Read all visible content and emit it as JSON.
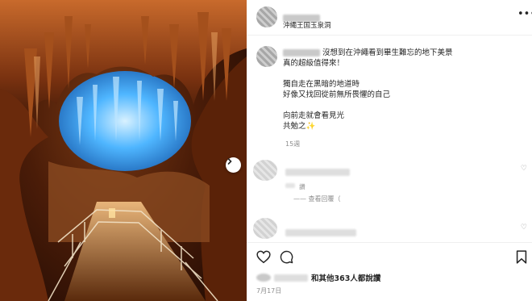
{
  "post": {
    "location": "沖繩王国玉泉洞",
    "caption": {
      "line1": "沒想到在沖繩看到畢生難忘的地下美景",
      "line2": "真的超級值得來！",
      "line3": "獨自走在黑暗的地道時",
      "line4": "好像又找回從前無所畏懼的自己",
      "line5": "向前走就會看見光",
      "line6": "共勉之✨"
    },
    "caption_time": "15週",
    "comment1_sub": "讚",
    "comment1_replies": "—— 查看回覆（",
    "likes_text": "和其他363人都說讚",
    "date": "7月17日"
  },
  "icons": {
    "more": "more-options-icon",
    "next": "chevron-right-icon",
    "heart": "heart-icon",
    "comment": "comment-icon",
    "bookmark": "bookmark-icon"
  },
  "colors": {
    "text": "#262626",
    "muted": "#8e8e8e",
    "cave_glow": "#4fb6ff",
    "cave_rock": "#8a3d12"
  }
}
